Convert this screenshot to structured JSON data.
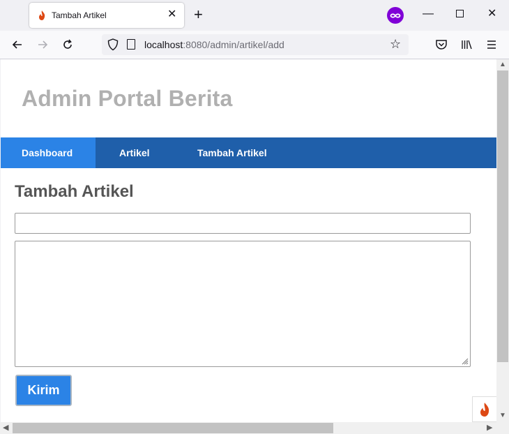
{
  "browser": {
    "tab_title": "Tambah Artikel",
    "tab_close": "✕",
    "new_tab": "+",
    "url_host": "localhost",
    "url_rest": ":8080/admin/artikel/add",
    "window_min": "—",
    "window_close": "✕"
  },
  "site": {
    "title": "Admin Portal Berita",
    "nav": [
      "Dashboard",
      "Artikel",
      "Tambah Artikel"
    ],
    "active_nav": "Dashboard"
  },
  "form": {
    "heading": "Tambah Artikel",
    "title_value": "",
    "body_value": "",
    "submit_label": "Kirim"
  },
  "colors": {
    "nav_bg": "#1f5faa",
    "nav_active": "#2b83e6",
    "button_bg": "#2b83e6",
    "title_gray": "#b0b0b0"
  }
}
